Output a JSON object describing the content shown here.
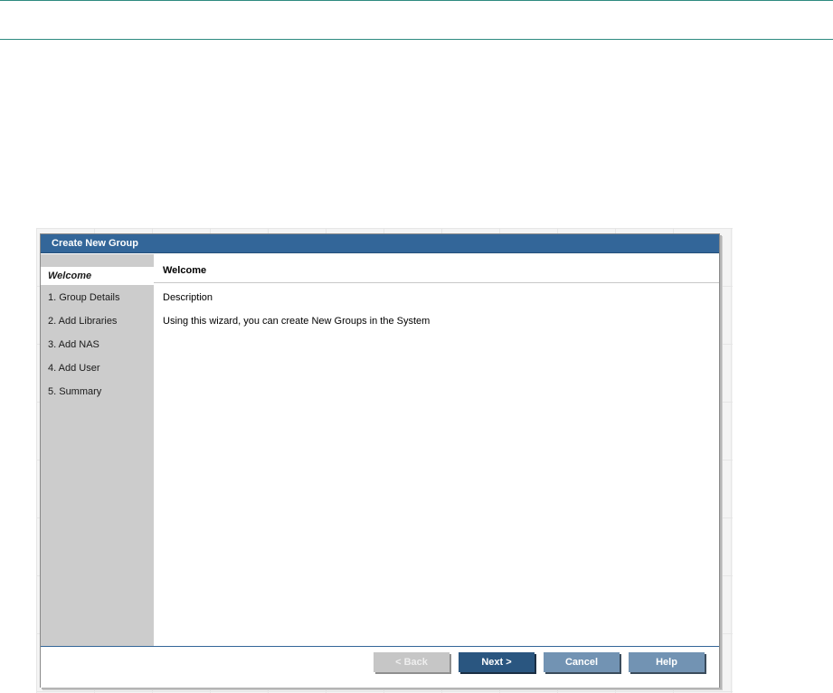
{
  "dialog": {
    "title": "Create New Group"
  },
  "sidebar": {
    "steps": [
      {
        "label": "Welcome",
        "active": true
      },
      {
        "label": "1. Group Details"
      },
      {
        "label": "2. Add Libraries"
      },
      {
        "label": "3. Add NAS"
      },
      {
        "label": "4. Add User"
      },
      {
        "label": "5. Summary"
      }
    ]
  },
  "content": {
    "title": "Welcome",
    "description_label": "Description",
    "description_text": "Using this wizard, you can create New Groups in the System"
  },
  "footer": {
    "back_label": "< Back",
    "next_label": "Next >",
    "cancel_label": "Cancel",
    "help_label": "Help"
  },
  "colors": {
    "title_bar": "#336699",
    "sidebar": "#cccccc",
    "primary_button": "#2a5680",
    "secondary_button": "#7293b3",
    "disabled_button": "#c6c6c6",
    "top_rule": "#2e8b80"
  }
}
